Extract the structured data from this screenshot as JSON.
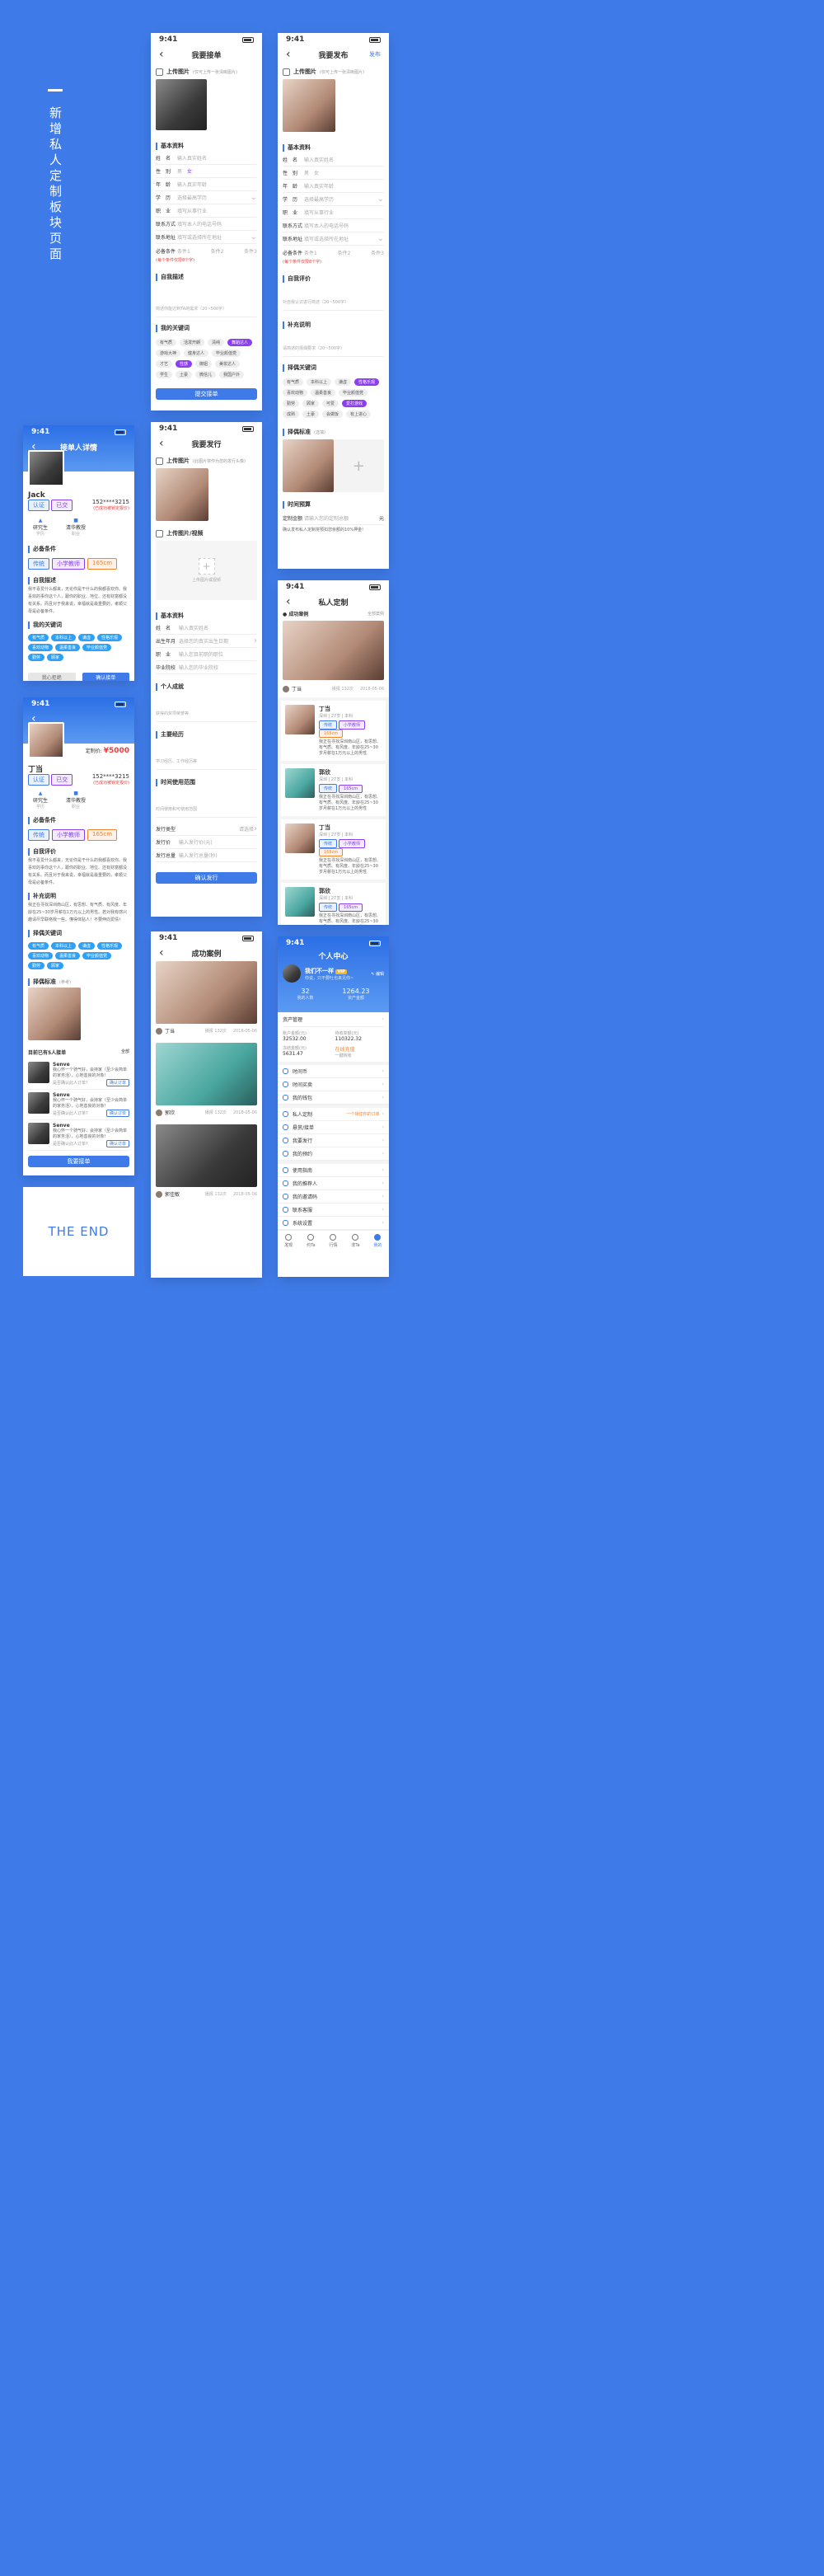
{
  "side": {
    "title": "新增私人定制板块页面",
    "end": "THE END"
  },
  "status": {
    "time": "9:41"
  },
  "common": {
    "upload_image": "上传图片",
    "upload_hint1": "(仅可上传一张清晰图片)",
    "basic_info": "基本资料",
    "self_desc": "自我描述",
    "self_eval": "自我评价",
    "my_keywords": "我的关键词",
    "required": "必备条件",
    "cond_hint": "(每个条件仅限8个字)",
    "cond1": "条件1",
    "cond2": "条件2",
    "cond3": "条件3",
    "name_lb": "姓　名",
    "name_ph": "输入真实姓名",
    "gender_lb": "性　别",
    "male": "男",
    "female": "女",
    "age_lb": "年　龄",
    "age_ph": "输入真实年龄",
    "edu_lb": "学　历",
    "edu_ph": "选择最高学历",
    "job_lb": "职　业",
    "job_ph": "填写从事行业",
    "phone_lb": "联系方式",
    "phone_ph": "填写本人的电话号码",
    "addr_lb": "联系地址",
    "addr_ph": "填写或选择所在地址",
    "desc_ph": "简述你能达到TA的需求（20~500字）",
    "eval_ph": "对自我认识进行简述（20~500字）",
    "supp": "补充说明",
    "supp_ph": "请简述的择偶要求（20~500字）",
    "mate_kw": "择偶关键词",
    "mate_std": "择偶标准",
    "mate_std_hint": "(选填)",
    "budget": "时间预算",
    "budget_lb": "定制金额",
    "budget_ph": "请输入您的定制总额",
    "yuan": "元",
    "budget_note": "确认发布私人定制将预扣您余额的10%押金!"
  },
  "s1": {
    "title": "我要接单",
    "submit": "提交接单",
    "tags": [
      "有气质",
      "活泼开朗",
      "清纯",
      "舞蹈达人",
      "游戏大神",
      "健身达人",
      "毕业颜值党",
      "才艺",
      "性感",
      "御姐",
      "美妆达人",
      "学生",
      "土豪",
      "微信儿",
      "我国户外"
    ]
  },
  "s2": {
    "title": "我要发布",
    "right": "发布",
    "tags": [
      "有气质",
      "本科以上",
      "谦虚",
      "性格乐观",
      "喜欢动物",
      "温柔善良",
      "毕业颜值党",
      "勤劳",
      "顾家",
      "可爱",
      "爱打游戏",
      "成熟",
      "土豪",
      "会做饭",
      "有上进心"
    ]
  },
  "s3": {
    "title": "接单人详情",
    "name": "Jack",
    "badge1": "认证",
    "badge2": "已交",
    "phone": "152****3215",
    "phone_note": "(已成功被锁定报价)",
    "edu": "研究生",
    "edu_sub": "学历",
    "job": "清华教授",
    "job_sub": "职业",
    "req_tags": [
      "传统",
      "小学教师",
      "165cm"
    ],
    "desc": "我不喜爱什么都来，无论你是干什么的我都喜欢你。我喜欢的事你这个人，跟你的职业、地位、还有财富都没有关系。而且对于我来说，幸福就是最重要的，孝顺父母是必备条件。",
    "kw": [
      "有气质",
      "本科以上",
      "谦虚",
      "性格乐观",
      "喜欢动物",
      "温柔善良",
      "毕业颜值党",
      "勤劳",
      "顾家"
    ],
    "btn_cancel": "我心拒绝",
    "btn_ok": "确认接单"
  },
  "s4": {
    "title": "我要发行",
    "upload_hint": "(此图片将作为您的发行头像)",
    "upload_video": "上传图片/视频",
    "video_hint": "上传图片或视频",
    "birth_lb": "出生年月",
    "birth_ph": "选择您的真实出生日期",
    "job2_ph": "输入您目前职的职位",
    "school_lb": "毕业院校",
    "school_ph": "输入您的毕业院校",
    "personal": "个人成就",
    "personal_ph": "获得的奖项荣誉等",
    "exp": "主要经历",
    "exp_ph": "学习经历、工作经历等",
    "range": "时间使用范围",
    "range_ph": "时间使用和可使用范围",
    "type_lb": "发行类型",
    "type_ph": "请选择",
    "price_lb": "发行价",
    "price_ph": "输入发行价(元)",
    "count_lb": "发行总量",
    "count_ph": "输入发行总量(秒)",
    "submit": "确认发行"
  },
  "s5": {
    "title": "私人定制",
    "success": "成功案例",
    "more": "全部案例",
    "case_name": "丁当",
    "case_meta": "播报 132次",
    "case_date": "2018-05-06",
    "list": [
      {
        "name": "丁当",
        "sub": "深圳 | 27岁 | 本科",
        "tags": [
          "传统",
          "小学教师",
          "165cm"
        ],
        "desc": "我正在寻找深圳南山区，有思想、有气质、有风度、年龄在25~30岁月薪在1万元以上的男性"
      },
      {
        "name": "郭欣",
        "sub": "深圳 | 27岁 | 本科",
        "tags": [
          "传统",
          "165cm"
        ],
        "desc": "我正在寻找深圳南山区，有思想、有气质、有风度、年龄在25~30岁月薪在1万元以上的男性"
      },
      {
        "name": "丁当",
        "sub": "深圳 | 27岁 | 本科",
        "tags": [
          "传统",
          "小学教师",
          "165cm"
        ],
        "desc": "我正在寻找深圳南山区，有思想、有气质、有风度、年龄在25~30岁月薪在1万元以上的男性"
      },
      {
        "name": "郭欣",
        "sub": "深圳 | 27岁 | 本科",
        "tags": [
          "传统",
          "165cm"
        ],
        "desc": "我正在寻找深圳南山区，有思想、有气质、有风度、年龄在25~30岁月薪在1万元以上的男性"
      }
    ]
  },
  "s6": {
    "price_lb": "定制价:",
    "price": "¥5000",
    "name": "丁当",
    "badge1": "认证",
    "badge2": "已交",
    "phone": "152****3215",
    "phone_note": "(已成功被锁定报价)",
    "edu": "研究生",
    "edu_sub": "学历",
    "job": "清华教授",
    "job_sub": "职业",
    "req_tags": [
      "传统",
      "小学教师",
      "165cm"
    ],
    "desc": "我不喜爱什么都来，无论你是干什么的我都喜欢你。我喜欢的事你这个人，跟你的职业、地位、还有财富都没有关系。而且对于我来说，幸福就是最重要的，孝顺父母是必备条件。",
    "supp": "我正在寻找深圳南山区，有思想、有气质、有风度、年龄在25~30岁月薪在1万元以上的男性。若对我有感兴趣请尽早联络我一些。懂得体贴人！不要伸向爱情！",
    "kw": [
      "有气质",
      "本科以上",
      "谦虚",
      "性格乐观",
      "喜欢动物",
      "温柔善良",
      "毕业颜值党",
      "勤劳",
      "顾家"
    ],
    "mate_std": "择偶标准",
    "mate_hint": "(参考)",
    "applicants": "目前已有5人接单",
    "all": "全部",
    "app_list": [
      {
        "name": "Senve",
        "msg": "我心怀一个骑气好，会持家（至少会简单的家务活），心地善良的对象！",
        "q": "是否确认此人订单?",
        "btn": "确认订单"
      },
      {
        "name": "Senve",
        "msg": "我心怀一个骑气好，会持家（至少会简单的家务活），心地善良的对象！",
        "q": "是否确认此人订单?",
        "btn": "确认订单"
      },
      {
        "name": "Senve",
        "msg": "我心怀一个骑气好，会持家（至少会简单的家务活），心地善良的对象！",
        "q": "是否确认此人订单?",
        "btn": "确认订单"
      }
    ],
    "submit": "我要接单"
  },
  "s7": {
    "title": "成功案例",
    "cases": [
      {
        "name": "丁当",
        "meta": "播报 132次",
        "date": "2018-05-06"
      },
      {
        "name": "郭欣",
        "meta": "播报 132次",
        "date": "2018-05-06"
      },
      {
        "name": "郭佳敏",
        "meta": "播报 132次",
        "date": "2018-05-06"
      }
    ]
  },
  "s8": {
    "title": "个人中心",
    "name": "我们不一样",
    "vip": "VIP",
    "sign": "你说，只不要吐也来见你~",
    "edit": "编辑",
    "stat1_v": "32",
    "stat1_l": "我的人数",
    "stat2_v": "1264.23",
    "stat2_l": "资产金额",
    "assets": "资产管理",
    "a1_l": "账户金额(元)",
    "a1_v": "32532.00",
    "a2_l": "待收单额(元)",
    "a2_v": "110322.32",
    "a3_l": "冻结金额(元)",
    "a3_v": "5631.47",
    "a4_l": "在线充值",
    "a4_v": "一键转账",
    "menu1": [
      "时间币",
      "时间买卖",
      "我的钱包"
    ],
    "menu2": [
      "私人定制",
      "悬赏/接单",
      "我要发行",
      "我的预约"
    ],
    "menu2_right": "一个锁住你的订单",
    "menu3": [
      "使用指南",
      "我的推荐人",
      "我的邀请码",
      "联系客服",
      "系统设置"
    ],
    "tabs": [
      "发现",
      "约Ta",
      "行情",
      "非Ta",
      "我的"
    ]
  }
}
